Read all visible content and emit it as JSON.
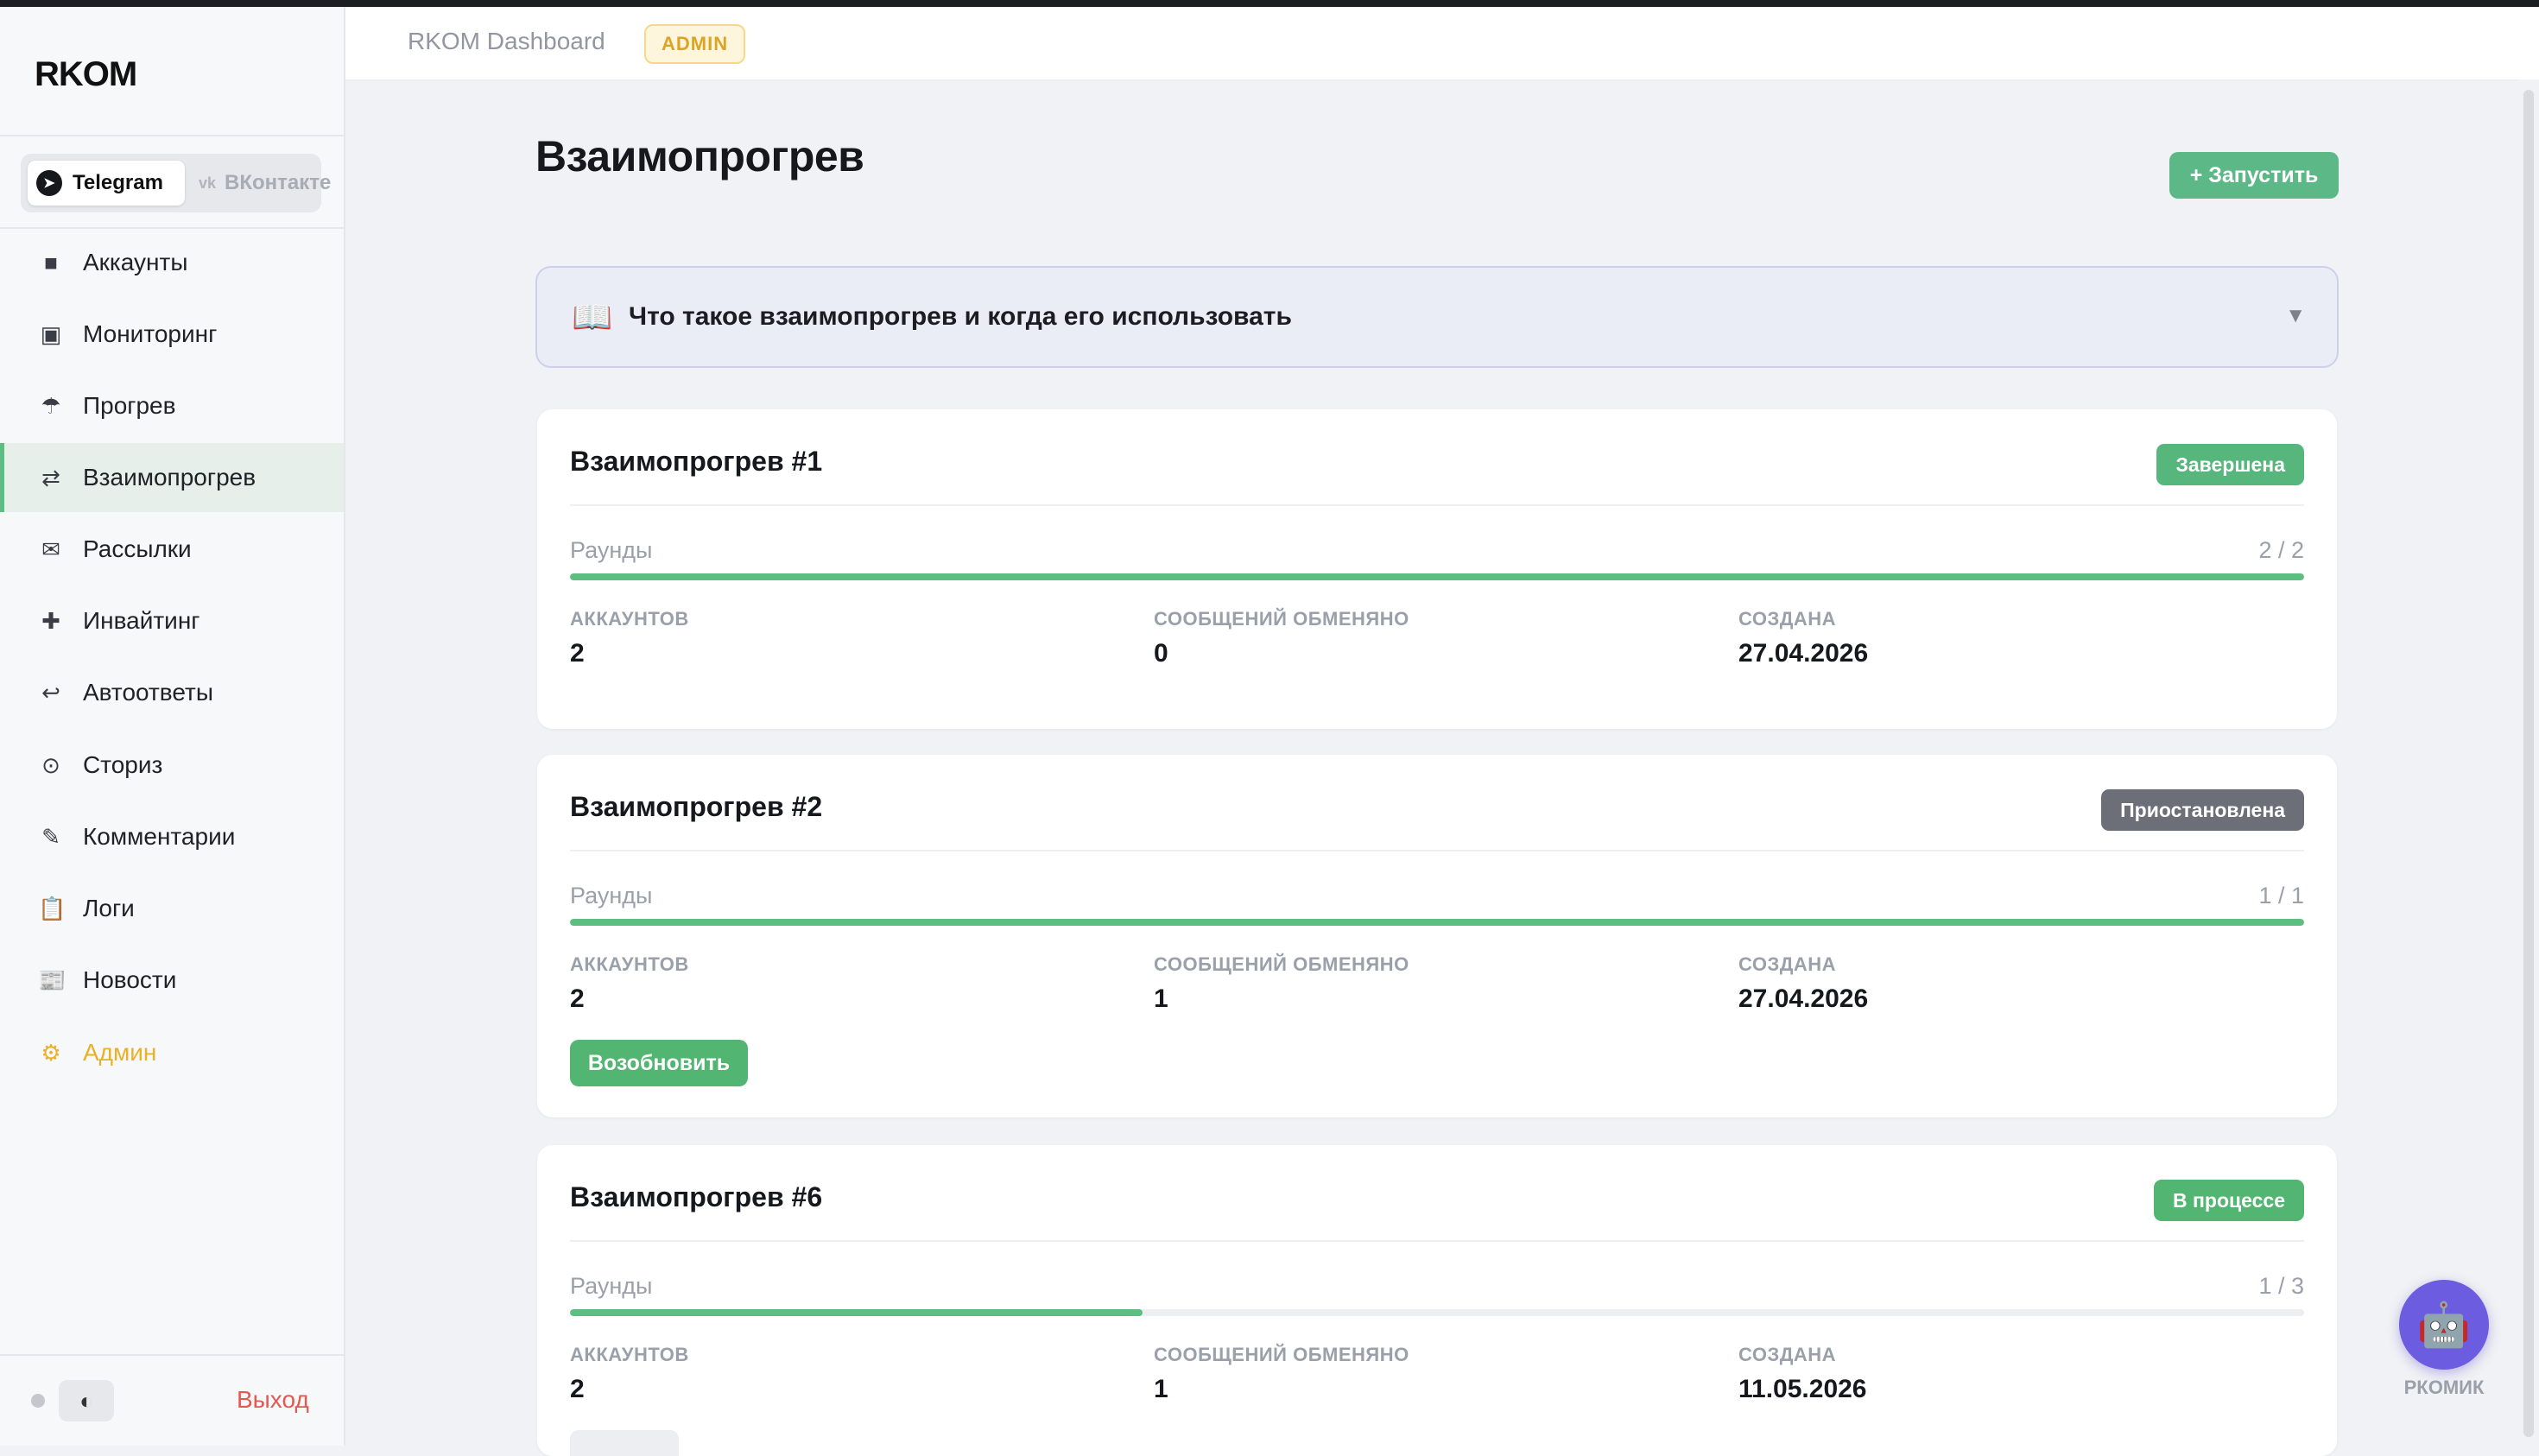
{
  "sidebar": {
    "logo": "RKOM",
    "platforms": [
      {
        "label": "Telegram",
        "icon": "telegram-icon",
        "active": true
      },
      {
        "label": "ВКонтакте",
        "icon": "vk-icon",
        "active": false
      }
    ],
    "nav": [
      {
        "label": "Аккаунты",
        "icon": "accounts-icon",
        "glyph": "■"
      },
      {
        "label": "Мониторинг",
        "icon": "monitoring-icon",
        "glyph": "▣"
      },
      {
        "label": "Прогрев",
        "icon": "umbrella-icon",
        "glyph": "☂"
      },
      {
        "label": "Взаимопрогрев",
        "icon": "swap-arrows-icon",
        "glyph": "⇄",
        "active": true
      },
      {
        "label": "Рассылки",
        "icon": "envelope-icon",
        "glyph": "✉"
      },
      {
        "label": "Инвайтинг",
        "icon": "plus-icon",
        "glyph": "✚"
      },
      {
        "label": "Автоответы",
        "icon": "reply-icon",
        "glyph": "↩"
      },
      {
        "label": "Сториз",
        "icon": "circle-dot-icon",
        "glyph": "⊙"
      },
      {
        "label": "Комментарии",
        "icon": "pencil-icon",
        "glyph": "✎"
      },
      {
        "label": "Логи",
        "icon": "clipboard-icon",
        "glyph": "📋"
      },
      {
        "label": "Новости",
        "icon": "newspaper-icon",
        "glyph": "📰"
      },
      {
        "label": "Админ",
        "icon": "gear-icon",
        "glyph": "⚙",
        "admin": true
      }
    ],
    "logout": "Выход"
  },
  "header": {
    "title": "RKOM Dashboard",
    "badge": "ADMIN"
  },
  "main": {
    "title": "Взаимопрогрев",
    "run_button": "+ Запустить",
    "info": {
      "text": "Что такое взаимопрогрев и когда его использовать",
      "icon": "book-icon",
      "chevron": "▼"
    },
    "stat_labels": {
      "accounts": "АККАУНТОВ",
      "messages": "СООБЩЕНИЙ ОБМЕНЯНО",
      "created": "СОЗДАНА"
    },
    "rounds_label": "Раунды",
    "cards": [
      {
        "title": "Взаимопрогрев #1",
        "status": "Завершена",
        "status_kind": "done",
        "rounds": "2 / 2",
        "progress": 1.0,
        "accounts": "2",
        "messages": "0",
        "created": "27.04.2026"
      },
      {
        "title": "Взаимопрогрев #2",
        "status": "Приостановлена",
        "status_kind": "paused",
        "rounds": "1 / 1",
        "progress": 1.0,
        "accounts": "2",
        "messages": "1",
        "created": "27.04.2026",
        "action": "Возобновить"
      },
      {
        "title": "Взаимопрогрев #6",
        "status": "В процессе",
        "status_kind": "running",
        "rounds": "1 / 3",
        "progress": 0.33,
        "accounts": "2",
        "messages": "1",
        "created": "11.05.2026"
      }
    ]
  },
  "assistant": {
    "label": "РКОМИК",
    "icon": "robot-icon"
  },
  "colors": {
    "accent": "#5cbf81",
    "admin": "#eab128",
    "logout": "#e05a52",
    "paused": "#6c6f78",
    "info_bg": "#eaecf6"
  }
}
